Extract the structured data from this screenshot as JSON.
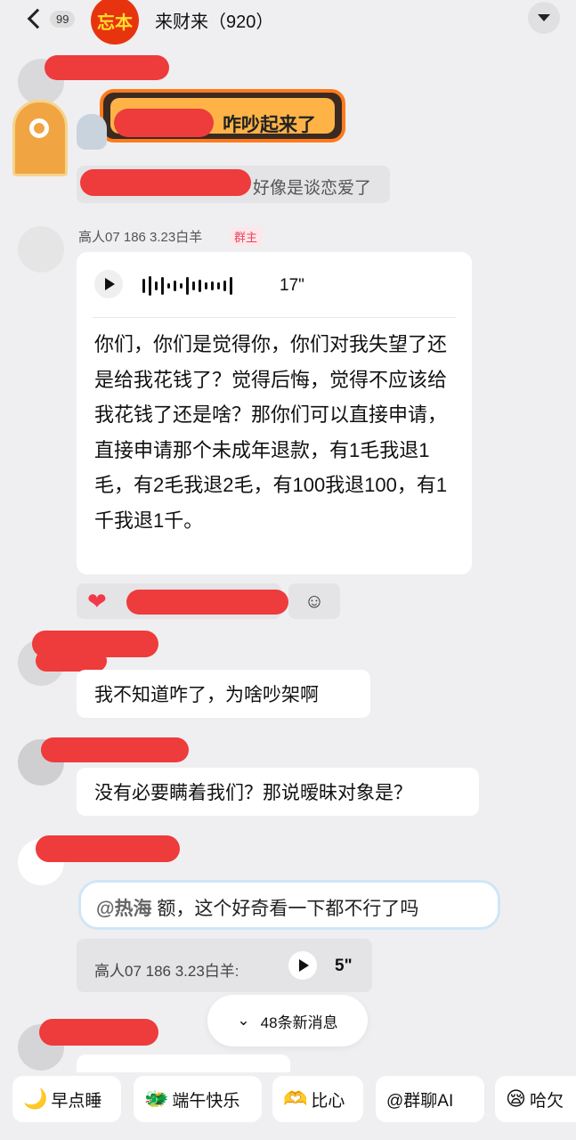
{
  "header": {
    "back_count": "99",
    "group_avatar_text": "忘本",
    "title": "来财来（920）"
  },
  "messages": {
    "banner_text": "咋吵起来了",
    "system_quote": "好像是谈恋爱了",
    "voice_sender": "高人07 186 3.23白羊",
    "owner_tag": "群主",
    "voice_duration": "17\"",
    "voice_transcript": "你们，你们是觉得你，你们对我失望了还是给我花钱了？觉得后悔，觉得不应该给我花钱了还是啥？那你们可以直接申请，直接申请那个未成年退款，有1毛我退1毛，有2毛我退2毛，有100我退100，有1千我退1千。",
    "reaction_icon": "heart-icon",
    "msg2": "我不知道咋了，为啥吵架啊",
    "msg3": "没有必要瞒着我们？那说暧昧对象是？",
    "msg4_mention": "@热海",
    "msg4_text": " 额，这个好奇看一下都不行了吗",
    "reply_sender": "高人07 186 3.23白羊:",
    "reply_duration": "5\""
  },
  "new_messages": "48条新消息",
  "quick_replies": [
    {
      "icon": "moon-icon",
      "label": "早点睡"
    },
    {
      "icon": "dragon-icon",
      "label": "端午快乐"
    },
    {
      "icon": "heart-hands-icon",
      "label": "比心"
    },
    {
      "icon": "at-icon",
      "label": "@群聊AI"
    },
    {
      "icon": "yawn-icon",
      "label": "哈欠"
    }
  ],
  "colors": {
    "redaction": "#ee3b3b",
    "background": "#efeff1",
    "owner_tag": "#e9455c"
  }
}
